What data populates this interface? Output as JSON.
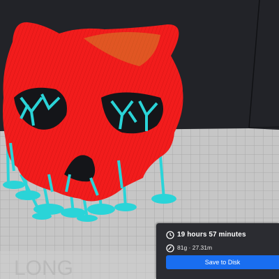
{
  "viewport": {
    "model_color": "#f21c1c",
    "support_color": "#2ad4d8",
    "plate_color": "#c9c9c9",
    "background_color": "#222328"
  },
  "print_info": {
    "time_icon": "clock-icon",
    "time_label": "19 hours 57 minutes",
    "material_icon": "weight-gauge-icon",
    "material_label": "81g · 27.31m"
  },
  "save_button": {
    "label": "Save to Disk",
    "color": "#196ef0"
  }
}
